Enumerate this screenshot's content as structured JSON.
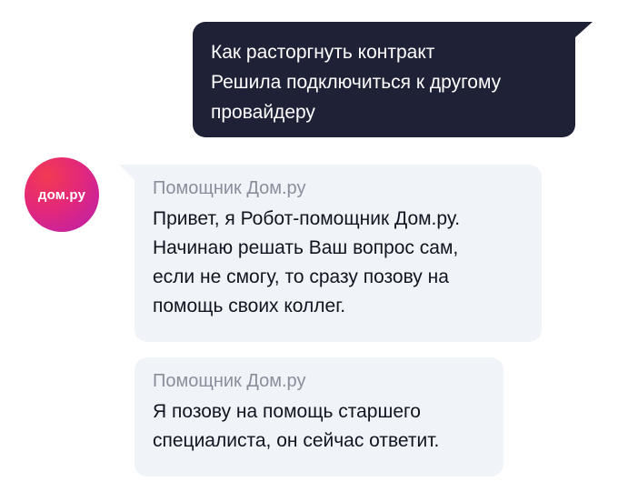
{
  "chat": {
    "user_message": {
      "lines": [
        "Как расторгнуть контракт",
        "Решила подключиться к другому",
        "провайдеру"
      ]
    },
    "bot": {
      "avatar_text": "дом.ру",
      "messages": [
        {
          "sender": "Помощник Дом.ру",
          "lines": [
            "Привет, я Робот-помощник Дом.ру.",
            "Начинаю решать Ваш вопрос сам,",
            "если не смогу, то сразу позову на",
            "помощь своих коллег."
          ]
        },
        {
          "sender": "Помощник Дом.ру",
          "lines": [
            "Я позову на помощь старшего",
            "специалиста, он сейчас ответит."
          ]
        }
      ]
    },
    "colors": {
      "user_bubble": "#1f2136",
      "bot_bubble": "#f0f3f8",
      "sender_text": "#8b8e9a",
      "avatar_gradient": [
        "#f23a52",
        "#e3287a",
        "#b81fb0"
      ]
    }
  }
}
